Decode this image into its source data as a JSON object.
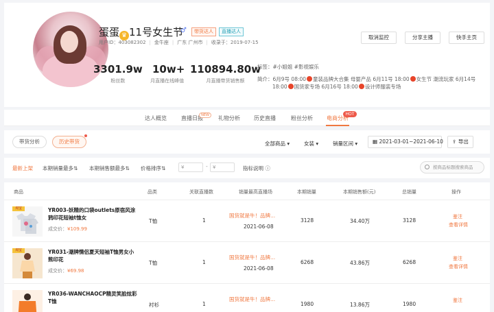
{
  "profile": {
    "name_prefix": "蛋蛋",
    "name_suffix": "11号女生节",
    "gender_symbol": "♂",
    "tags": [
      "带货达人",
      "直播达人"
    ],
    "user_id": "用户ID：403082302",
    "level": "金牛座",
    "location": "广东 广州市",
    "since": "收录于：2019-07-15",
    "buttons": [
      "取消监控",
      "分享主播",
      "快手主页"
    ],
    "stats": [
      {
        "value": "3301.9w",
        "label": "粉丝数"
      },
      {
        "value": "10w+",
        "label": "月直播在线峰值"
      },
      {
        "value": "110894.80w",
        "label": "月直播带货销售额"
      }
    ],
    "labels_text": "标签：#小姐姐 #影视娱乐",
    "intro_label": "简介：",
    "intro_line1": "6月9号 08:00",
    "intro_line1_b": "童装品牌大合集 母婴产品 6月11号 18:00",
    "intro_line1_c": "女生节 潮流玩家 6月14号",
    "intro_line2": "18:00",
    "intro_line2_b": "国货家专场 6月16号 18:00",
    "intro_line2_c": "设计师服装专场"
  },
  "tabs": [
    "达人概览",
    "直播日报",
    "礼物分析",
    "历史直播",
    "粉丝分析",
    "电商分析"
  ],
  "tab_new_badge": "NEW",
  "tab_hot_badge": "HOT",
  "filters": {
    "btn1": "带货分析",
    "btn2": "历史带货",
    "dd1": "全部商品",
    "dd2": "女装",
    "dd3": "销量区间",
    "date_range": "2021-03-01~2021-06-10",
    "export": "导出"
  },
  "sort": {
    "items": [
      "最新上架",
      "本期销量最多",
      "本期销售额最多",
      "价格排序"
    ],
    "range_from": "¥",
    "range_to": "¥",
    "range_sep": "-",
    "help": "指标说明",
    "search_placeholder": "按商品标题搜索商品"
  },
  "table": {
    "headers": [
      "商品",
      "品类",
      "关联直播数",
      "销量最高直播场",
      "本期销量",
      "本期销售额(元)",
      "总销量",
      "操作"
    ],
    "badge": "淘宝",
    "rows": [
      {
        "title": "YR003-妖精的口袋outlets原宿风涂鸦印花短袖t恤女",
        "price_label": "成交价：",
        "price": "¥109.99",
        "category": "T恤",
        "lives": "1",
        "hot_title": "国货就是牛！品牌...",
        "hot_date": "2021-06-08",
        "sales": "3128",
        "revenue": "34.40万",
        "total": "3128",
        "op1": "鉴注",
        "op2": "查看详情"
      },
      {
        "title": "YR031-潮牌情侣夏天短袖T恤男女小熊印花",
        "price_label": "成交价：",
        "price": "¥69.98",
        "category": "T恤",
        "lives": "1",
        "hot_title": "国货就是牛！品牌...",
        "hot_date": "2021-06-08",
        "sales": "6268",
        "revenue": "43.86万",
        "total": "6268",
        "op1": "鉴注",
        "op2": "查看详情"
      },
      {
        "title": "YR036-WANCHAOCP精灵笑脸炫彩T恤",
        "price_label": "",
        "price": "",
        "category": "衬衫",
        "lives": "1",
        "hot_title": "国货就是牛！品牌...",
        "hot_date": "",
        "sales": "1980",
        "revenue": "13.86万",
        "total": "1980",
        "op1": "鉴注",
        "op2": ""
      }
    ]
  },
  "colors": {
    "accent": "#f07840",
    "hot": "#ee5a4a",
    "bg": "#f3f4f7"
  }
}
